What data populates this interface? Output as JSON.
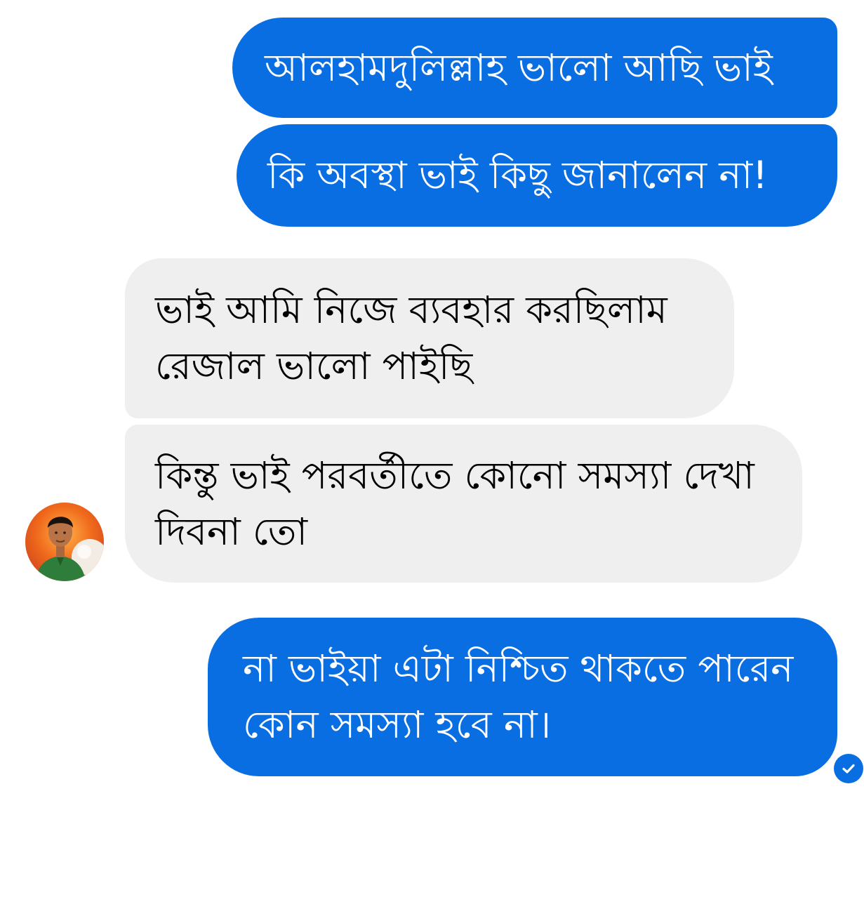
{
  "conversation": {
    "messages": [
      {
        "direction": "sent",
        "text": "আলহামদুলিল্লাহ ভালো আছি ভাই"
      },
      {
        "direction": "sent",
        "text": "কি অবস্থা ভাই কিছু জানালেন না!"
      },
      {
        "direction": "received",
        "text": "ভাই আমি নিজে ব্যবহার করছিলাম\nরেজাল ভালো পাইছি"
      },
      {
        "direction": "received",
        "text": "কিন্তু ভাই পরবর্তীতে কোনো সমস্যা দেখা\nদিবনা তো"
      },
      {
        "direction": "sent",
        "text": "না ভাইয়া এটা নিশ্চিত থাকতে পারেন\nকোন সমস্যা হবে না।"
      }
    ],
    "status_icon": "check-circle-icon",
    "colors": {
      "sent_bubble": "#0a6ee3",
      "received_bubble": "#efefef",
      "sent_text": "#ffffff",
      "received_text": "#000000"
    }
  }
}
